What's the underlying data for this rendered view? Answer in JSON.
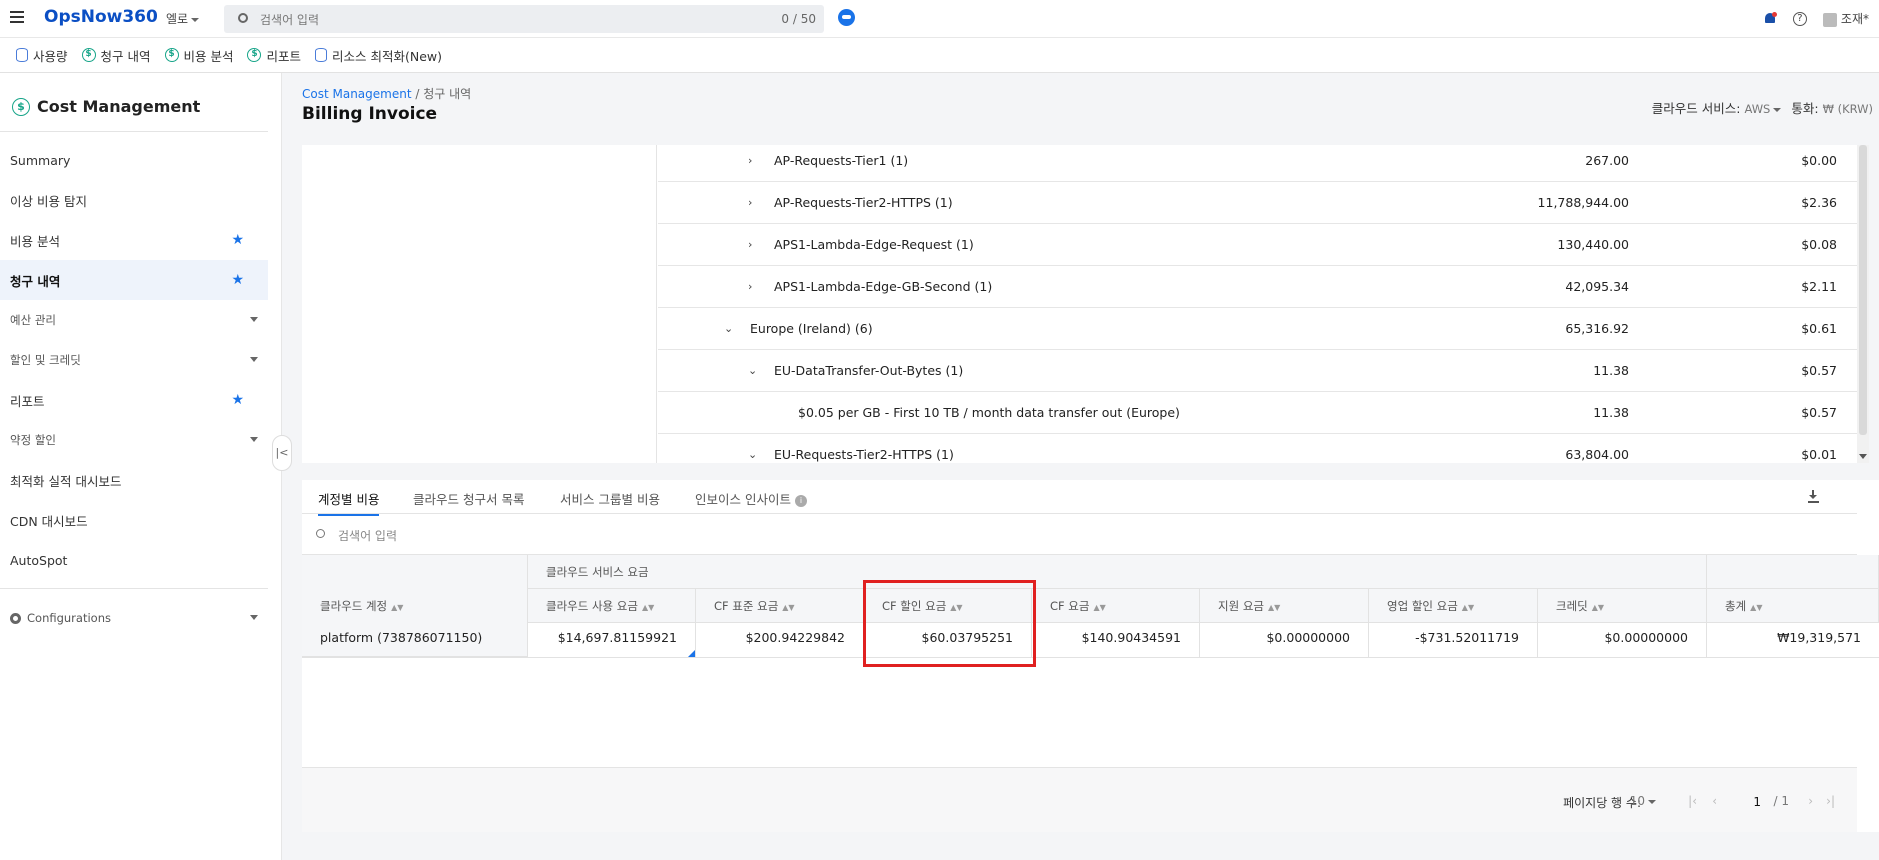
{
  "topbar": {
    "logo": "OpsNow360",
    "org": "엘로",
    "search_placeholder": "검색어 입력",
    "search_count": "0 / 50",
    "user": "조재*"
  },
  "subnav": [
    "사용량",
    "청구 내역",
    "비용 분석",
    "리포트",
    "리소스 최적화(New)"
  ],
  "sidebar": {
    "title": "Cost Management",
    "items": [
      {
        "label": "Summary"
      },
      {
        "label": "이상 비용 탐지"
      },
      {
        "label": "비용 분석"
      },
      {
        "label": "청구 내역"
      },
      {
        "label": "예산 관리"
      },
      {
        "label": "할인 및 크레딧"
      },
      {
        "label": "리포트"
      },
      {
        "label": "약정 할인"
      },
      {
        "label": "최적화 실적 대시보드"
      },
      {
        "label": "CDN 대시보드"
      },
      {
        "label": "AutoSpot"
      }
    ],
    "configurations": "Configurations",
    "collapse": "|<"
  },
  "header": {
    "breadcrumb_link": "Cost Management",
    "breadcrumb_sep": "/",
    "breadcrumb_current": "청구 내역",
    "title": "Billing Invoice",
    "cloud_service_label": "클라우드 서비스:",
    "cloud_service_value": "AWS",
    "currency_label": "통화:",
    "currency_value": "₩ (KRW)"
  },
  "tree_rows": [
    {
      "label": "AP-Requests-Tier1 (1)",
      "qty": "267.00",
      "cost": "$0.00"
    },
    {
      "label": "AP-Requests-Tier2-HTTPS (1)",
      "qty": "11,788,944.00",
      "cost": "$2.36"
    },
    {
      "label": "APS1-Lambda-Edge-Request (1)",
      "qty": "130,440.00",
      "cost": "$0.08"
    },
    {
      "label": "APS1-Lambda-Edge-GB-Second (1)",
      "qty": "42,095.34",
      "cost": "$2.11"
    },
    {
      "label": "Europe (Ireland) (6)",
      "qty": "65,316.92",
      "cost": "$0.61"
    },
    {
      "label": "EU-DataTransfer-Out-Bytes (1)",
      "qty": "11.38",
      "cost": "$0.57"
    },
    {
      "label": "$0.05 per GB - First 10 TB / month data transfer out (Europe)",
      "qty": "11.38",
      "cost": "$0.57"
    },
    {
      "label": "EU-Requests-Tier2-HTTPS (1)",
      "qty": "63,804.00",
      "cost": "$0.01"
    }
  ],
  "tabs": [
    "계정별 비용",
    "클라우드 청구서 목록",
    "서비스 그룹별 비용",
    "인보이스 인사이트"
  ],
  "table": {
    "search_placeholder": "검색어 입력",
    "col_account": "클라우드 계정",
    "group_header": "클라우드 서비스 요금",
    "columns": [
      "클라우드 사용 요금",
      "CF 표준 요금",
      "CF 할인 요금",
      "CF 요금",
      "지원 요금",
      "영업 할인 요금",
      "크레딧"
    ],
    "col_total": "총계",
    "rows": [
      {
        "account": "platform (738786071150)",
        "values": [
          "$14,697.81159921",
          "$200.94229842",
          "$60.03795251",
          "$140.90434591",
          "$0.00000000",
          "-$731.52011719",
          "$0.00000000"
        ],
        "total": "₩19,319,571"
      }
    ]
  },
  "pagination": {
    "rows_label": "페이지당 행 수:",
    "rows_value": "10",
    "current": "1",
    "total": "/ 1"
  },
  "colors": {
    "brand": "#0b4fc4",
    "accent": "#1a73e8",
    "highlight": "#e02020",
    "dollar_icon": "#17a589"
  }
}
